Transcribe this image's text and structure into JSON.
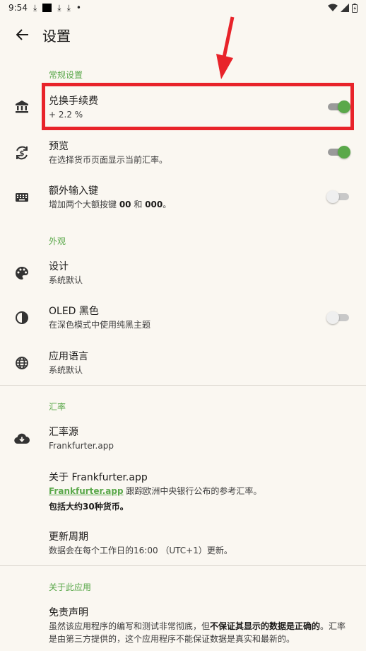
{
  "status": {
    "time": "9:54"
  },
  "header": {
    "title": "设置"
  },
  "sections": {
    "general": "常规设置",
    "appearance": "外观",
    "rates": "汇率",
    "about": "关于此应用"
  },
  "settings": {
    "fee": {
      "title": "兑换手续费",
      "sub": "+ 2.2 %"
    },
    "preview": {
      "title": "预览",
      "sub": "在选择货币页面显示当前汇率。"
    },
    "extra_keys": {
      "title": "额外输入键",
      "sub_pre": "增加两个大额按键 ",
      "k1": "00",
      "sub_mid": " 和 ",
      "k2": "000",
      "sub_post": "。"
    },
    "design": {
      "title": "设计",
      "sub": "系统默认"
    },
    "oled": {
      "title": "OLED 黑色",
      "sub": "在深色模式中使用纯黑主题"
    },
    "language": {
      "title": "应用语言",
      "sub": "系统默认"
    },
    "source": {
      "title": "汇率源",
      "sub": "Frankfurter.app"
    },
    "about_source": {
      "title": "关于 Frankfurter.app",
      "link": "Frankfurter.app",
      "sub": " 跟踪欧洲中央银行公布的参考汇率。",
      "bold": "包括大约30种货币。"
    },
    "update": {
      "title": "更新周期",
      "sub": "数据会在每个工作日的16:00 （UTC+1）更新。"
    },
    "disclaimer": {
      "title": "免责声明",
      "line1_pre": "虽然该应用程序的编写和测试非常彻底，但",
      "line1_bold": "不保证其显示的数据是正确的",
      "line1_post": "。汇率",
      "line2": "是由第三方提供的，这个应用程序不能保证数据是真实和最新的。"
    }
  },
  "toggles": {
    "fee": true,
    "preview": true,
    "extra_keys": false,
    "oled": false
  },
  "colors": {
    "accent": "#5aa84a",
    "highlight": "#e8232a",
    "background": "#faf7f1"
  }
}
